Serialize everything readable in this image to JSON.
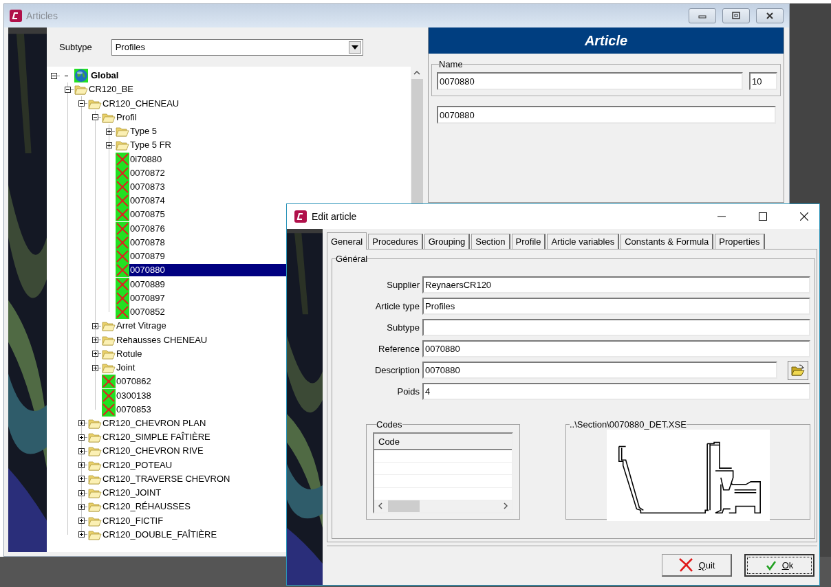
{
  "articles_window": {
    "title": "Articles",
    "subtype_label": "Subtype",
    "subtype_value": "Profiles",
    "tree": [
      {
        "kind": "root",
        "label": "Global",
        "expanded": true,
        "children": [
          {
            "kind": "folder",
            "label": "CR120_BE",
            "expanded": true,
            "children": [
              {
                "kind": "folder",
                "label": "CR120_CHENEAU",
                "expanded": true,
                "children": [
                  {
                    "kind": "folder",
                    "label": "Profil",
                    "expanded": true,
                    "children": [
                      {
                        "kind": "folder",
                        "label": "Type 5",
                        "expanded": false
                      },
                      {
                        "kind": "folder",
                        "label": "Type 5 FR",
                        "expanded": false
                      },
                      {
                        "kind": "article",
                        "label": "0i70880",
                        "selected": false
                      },
                      {
                        "kind": "article",
                        "label": "0070872",
                        "selected": false
                      },
                      {
                        "kind": "article",
                        "label": "0070873",
                        "selected": false
                      },
                      {
                        "kind": "article",
                        "label": "0070874",
                        "selected": false
                      },
                      {
                        "kind": "article",
                        "label": "0070875",
                        "selected": false
                      },
                      {
                        "kind": "article",
                        "label": "0070876",
                        "selected": false
                      },
                      {
                        "kind": "article",
                        "label": "0070878",
                        "selected": false
                      },
                      {
                        "kind": "article",
                        "label": "0070879",
                        "selected": false
                      },
                      {
                        "kind": "article",
                        "label": "0070880",
                        "selected": true
                      },
                      {
                        "kind": "article",
                        "label": "0070889",
                        "selected": false
                      },
                      {
                        "kind": "article",
                        "label": "0070897",
                        "selected": false
                      },
                      {
                        "kind": "article",
                        "label": "0070852",
                        "selected": false
                      }
                    ]
                  },
                  {
                    "kind": "folder",
                    "label": "Arret Vitrage",
                    "expanded": false
                  },
                  {
                    "kind": "folder",
                    "label": "Rehausses CHENEAU",
                    "expanded": false
                  },
                  {
                    "kind": "folder",
                    "label": "Rotule",
                    "expanded": false
                  },
                  {
                    "kind": "folder",
                    "label": "Joint",
                    "expanded": false
                  },
                  {
                    "kind": "article",
                    "label": "0070862",
                    "selected": false
                  },
                  {
                    "kind": "article",
                    "label": "0300138",
                    "selected": false
                  },
                  {
                    "kind": "article",
                    "label": "0070853",
                    "selected": false
                  }
                ]
              },
              {
                "kind": "folder",
                "label": "CR120_CHEVRON PLAN",
                "expanded": false
              },
              {
                "kind": "folder",
                "label": "CR120_SIMPLE FAÎTIÈRE",
                "expanded": false
              },
              {
                "kind": "folder",
                "label": "CR120_CHEVRON RIVE",
                "expanded": false
              },
              {
                "kind": "folder",
                "label": "CR120_POTEAU",
                "expanded": false
              },
              {
                "kind": "folder",
                "label": "CR120_TRAVERSE CHEVRON",
                "expanded": false
              },
              {
                "kind": "folder",
                "label": "CR120_JOINT",
                "expanded": false
              },
              {
                "kind": "folder",
                "label": "CR120_RÉHAUSSES",
                "expanded": false
              },
              {
                "kind": "folder",
                "label": "CR120_FICTIF",
                "expanded": false
              },
              {
                "kind": "folder",
                "label": "CR120_DOUBLE_FAÎTIÈRE",
                "expanded": false
              }
            ]
          }
        ]
      }
    ],
    "article_panel": {
      "header": "Article",
      "name_label": "Name",
      "name_value": "0070880",
      "name_number": "10",
      "description_value": "0070880"
    }
  },
  "edit_dialog": {
    "title": "Edit article",
    "tabs": [
      {
        "label": "General",
        "selected": true
      },
      {
        "label": "Procedures",
        "selected": false
      },
      {
        "label": "Grouping",
        "selected": false
      },
      {
        "label": "Section",
        "selected": false
      },
      {
        "label": "Profile",
        "selected": false
      },
      {
        "label": "Article variables",
        "selected": false
      },
      {
        "label": "Constants & Formula",
        "selected": false
      },
      {
        "label": "Properties",
        "selected": false
      }
    ],
    "group_title": "Général",
    "fields": [
      {
        "label": "Supplier",
        "value": "ReynaersCR120",
        "kind": "text"
      },
      {
        "label": "Article type",
        "value": "Profiles",
        "kind": "text"
      },
      {
        "label": "Subtype",
        "kind": "text"
      },
      {
        "label": "Reference",
        "value": "0070880",
        "kind": "text"
      },
      {
        "label": "Description",
        "value": "0070880",
        "kind": "browse"
      },
      {
        "label": "Poids",
        "value": "4",
        "kind": "text"
      }
    ],
    "codes": {
      "title": "Codes",
      "columns": [
        "Code"
      ]
    },
    "section": {
      "title": "..\\Section\\0070880_DET.XSE"
    },
    "buttons": [
      {
        "label": "Quit",
        "kind": "cancel",
        "mnemonic": true,
        "focused": false
      },
      {
        "label": "Ok",
        "kind": "confirm",
        "mnemonic": true,
        "focused": true
      }
    ]
  }
}
